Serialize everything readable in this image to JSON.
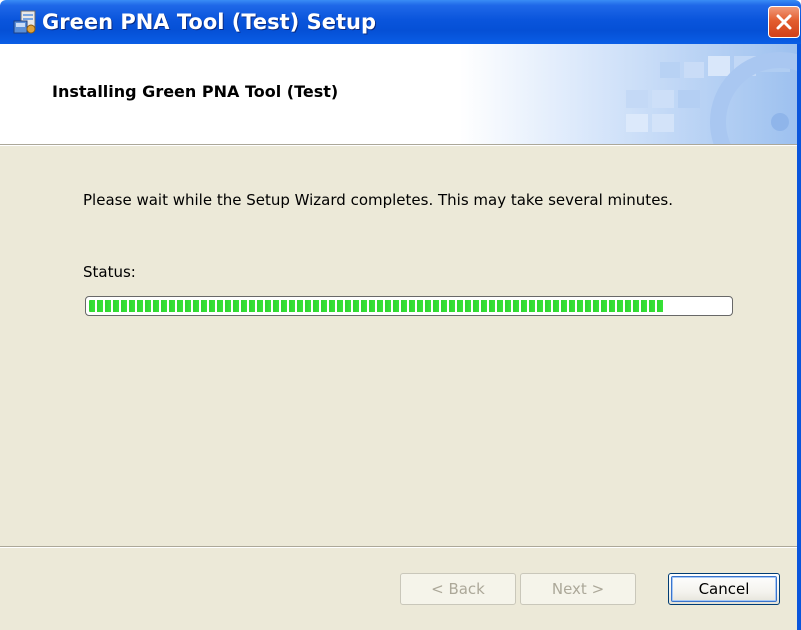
{
  "window": {
    "title": "Green PNA Tool (Test) Setup",
    "icons": {
      "app": "installer-icon",
      "close": "close-icon"
    }
  },
  "banner": {
    "title": "Installing Green PNA Tool (Test)"
  },
  "body": {
    "instruction": "Please wait while the Setup Wizard completes.  This may take several minutes.",
    "status_label": "Status:",
    "progress_fraction": 0.9,
    "progress_color": "#37e337"
  },
  "footer": {
    "back_label": "< Back",
    "next_label": "Next >",
    "cancel_label": "Cancel"
  },
  "colors": {
    "titlebar": "#0550d6",
    "dialog_bg": "#ece9d8",
    "close": "#e35e2f"
  }
}
